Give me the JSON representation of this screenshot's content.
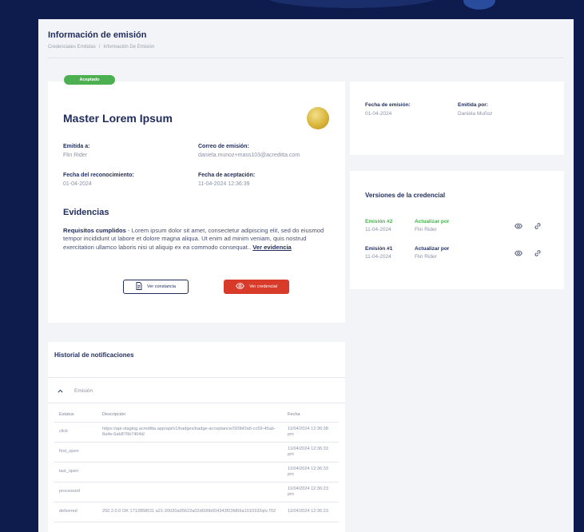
{
  "header": {
    "title": "Información de emisión",
    "breadcrumb": [
      "Credenciales Emitidas",
      "Información De Emisión"
    ],
    "breadcrumb_sep": "/"
  },
  "status_badge": "Aceptado",
  "credential": {
    "title": "Master Lorem Ipsum",
    "fields": {
      "issued_to_label": "Emitida a:",
      "issued_to_value": "Flin Rider",
      "email_label": "Correo de emisión:",
      "email_value": "daniela.munoz+mass103@acreditta.com",
      "recognition_date_label": "Fecha del reconocimiento:",
      "recognition_date_value": "01-04-2024",
      "accept_date_label": "Fecha de aceptación:",
      "accept_date_value": "11-04-2024 12:36:39"
    },
    "evidence_title": "Evidencias",
    "requirements_label": "Requisitos cumplidos",
    "requirements_text": " - Lorem ipsum dolor sit amet, consectetur adipiscing elit, sed do eiusmod tempor incididunt ut labore et dolore magna aliqua. Ut enim ad minim veniam, quis nostrud exercitation ullamco laboris nisi ut aliquip ex ea commodo consequat.. ",
    "evidence_link": "Ver evidencia",
    "btn_constancia": "Ver constancia",
    "btn_credencial": "Ver credencial"
  },
  "emission": {
    "date_label": "Fecha de emisión:",
    "date_value": "01-04-2024",
    "issuer_label": "Emitida por:",
    "issuer_value": "Daniela Muñoz"
  },
  "versions": {
    "title": "Versiones de la credencial",
    "items": [
      {
        "label": "Emisión #2",
        "date": "11-04-2024",
        "updated_label": "Actualizar por",
        "updated_by": "Flin Rider",
        "color": "#4caf50"
      },
      {
        "label": "Emisión #1",
        "date": "11-04-2024",
        "updated_label": "Actualizar por",
        "updated_by": "Flin Rider",
        "color": "#1f2c5c"
      }
    ]
  },
  "history": {
    "title": "Historial de notificaciones",
    "accordion_label": "Emisión",
    "columns": [
      "Estatus",
      "Descripción",
      "Fecha"
    ],
    "rows": [
      {
        "status": "click",
        "desc": "https://api-staging.acreditta.app/api/v1/badges/badge-acceptance/029bf2a6-cc59-45ab-8a4e-6ab876b7404d/",
        "date": "11/04/2024 12:36:38 pm"
      },
      {
        "status": "first_open",
        "desc": "",
        "date": "11/04/2024 12:36:33 pm"
      },
      {
        "status": "last_open",
        "desc": "",
        "date": "11/04/2024 12:36:33 pm"
      },
      {
        "status": "processed",
        "desc": "",
        "date": "11/04/2024 12:36:23 pm"
      },
      {
        "status": "delivered",
        "desc": "250 2.0.0 OK 1712858011 a21-20020a05622a02d600b004343f23fd59a1010102qtv.702",
        "date": "11/04/2024 12:36:23"
      }
    ]
  },
  "colors": {
    "accent": "#1f2c5c",
    "success": "#4caf50",
    "danger": "#d93b2b",
    "background": "#0d1b4d"
  }
}
